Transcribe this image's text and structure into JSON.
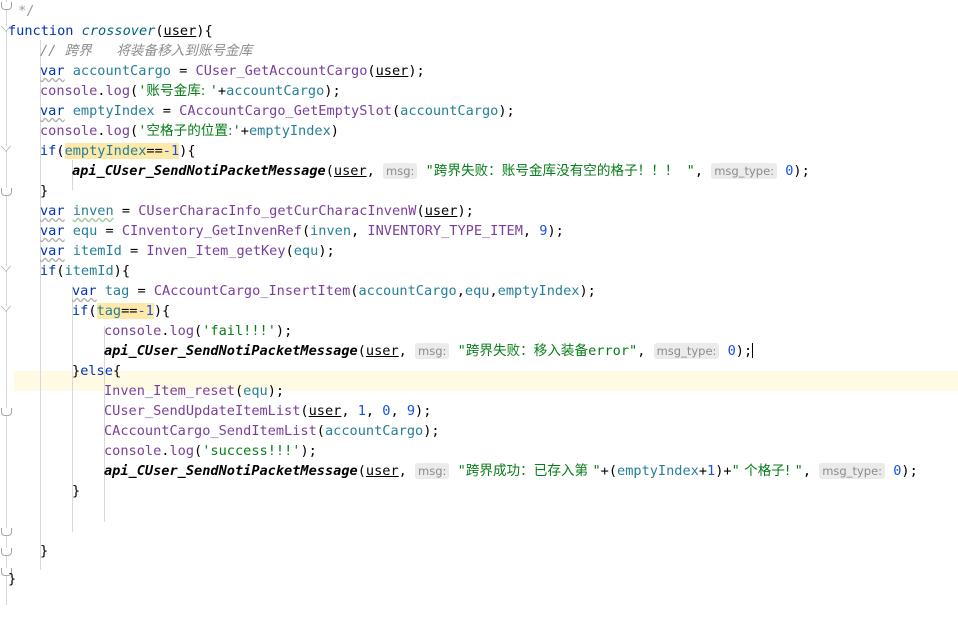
{
  "editor": {
    "app": "code-editor",
    "language": "JavaScript",
    "background": "#ffffff",
    "current_line_highlight": "#fffae3",
    "token_highlight": "#ffe9a8",
    "caret_line_index": 17
  },
  "colors": {
    "keyword": "#0033b3",
    "string": "#067d17",
    "number": "#1750eb",
    "comment": "#8c8c8c",
    "local_variable": "#267f99",
    "function_call": "#7a3e9d",
    "hint_chip_bg": "#ebebeb",
    "hint_chip_text": "#8c8c8c",
    "gutter_line": "#d6d6d6",
    "indent_guide": "#d8d8d8"
  },
  "hints": {
    "msg": "msg:",
    "msg_type": "msg_type:"
  },
  "lines": [
    {
      "i": 0,
      "indent": 1,
      "text": "*/"
    },
    {
      "i": 1,
      "indent": 0,
      "text": "function crossover(user){"
    },
    {
      "i": 2,
      "indent": 1,
      "text": "// 跨界   将装备移入到账号金库"
    },
    {
      "i": 3,
      "indent": 1,
      "text": "var accountCargo = CUser_GetAccountCargo(user);"
    },
    {
      "i": 4,
      "indent": 1,
      "text": "console.log('账号金库: '+accountCargo);"
    },
    {
      "i": 5,
      "indent": 1,
      "text": "var emptyIndex = CAccountCargo_GetEmptySlot(accountCargo);"
    },
    {
      "i": 6,
      "indent": 1,
      "text": "console.log('空格子的位置:'+emptyIndex)"
    },
    {
      "i": 7,
      "indent": 1,
      "text": "if(emptyIndex==-1){"
    },
    {
      "i": 8,
      "indent": 2,
      "text": "api_CUser_SendNotiPacketMessage(user, msg: \"跨界失败：账号金库没有空的格子！！！\", msg_type: 0);"
    },
    {
      "i": 9,
      "indent": 1,
      "text": "}"
    },
    {
      "i": 10,
      "indent": 1,
      "text": "var inven = CUserCharacInfo_getCurCharacInvenW(user);"
    },
    {
      "i": 11,
      "indent": 1,
      "text": "var equ = CInventory_GetInvenRef(inven, INVENTORY_TYPE_ITEM, 9);"
    },
    {
      "i": 12,
      "indent": 1,
      "text": "var itemId = Inven_Item_getKey(equ);"
    },
    {
      "i": 13,
      "indent": 1,
      "text": "if(itemId){"
    },
    {
      "i": 14,
      "indent": 2,
      "text": "var tag = CAccountCargo_InsertItem(accountCargo,equ,emptyIndex);"
    },
    {
      "i": 15,
      "indent": 2,
      "text": "if(tag==-1){"
    },
    {
      "i": 16,
      "indent": 3,
      "text": "console.log('fail!!!');"
    },
    {
      "i": 17,
      "indent": 3,
      "text": "api_CUser_SendNotiPacketMessage(user, msg: \"跨界失败：移入装备error\", msg_type: 0);"
    },
    {
      "i": 18,
      "indent": 2,
      "text": "}else{"
    },
    {
      "i": 19,
      "indent": 3,
      "text": "Inven_Item_reset(equ);"
    },
    {
      "i": 20,
      "indent": 3,
      "text": "CUser_SendUpdateItemList(user, 1, 0, 9);"
    },
    {
      "i": 21,
      "indent": 3,
      "text": "CAccountCargo_SendItemList(accountCargo);"
    },
    {
      "i": 22,
      "indent": 3,
      "text": "console.log('success!!!');"
    },
    {
      "i": 23,
      "indent": 3,
      "text": "api_CUser_SendNotiPacketMessage(user, msg: \"跨界成功：已存入第 \"+(emptyIndex+1)+\" 个格子! \", msg_type: 0);"
    },
    {
      "i": 24,
      "indent": 2,
      "text": "}"
    },
    {
      "i": 25,
      "indent": 1,
      "text": "}"
    },
    {
      "i": 26,
      "indent": 0,
      "text": "}"
    }
  ],
  "gutter": {
    "markers": [
      {
        "type": "fold-end",
        "line": 0
      },
      {
        "type": "fold-open",
        "line": 1
      },
      {
        "type": "fold-open",
        "line": 7
      },
      {
        "type": "fold-end",
        "line": 9
      },
      {
        "type": "fold-open",
        "line": 13
      },
      {
        "type": "fold-open",
        "line": 15
      },
      {
        "type": "fold-end",
        "line": 18
      },
      {
        "type": "fold-end",
        "line": 24
      },
      {
        "type": "fold-end",
        "line": 25
      },
      {
        "type": "fold-end",
        "line": 26
      }
    ]
  }
}
